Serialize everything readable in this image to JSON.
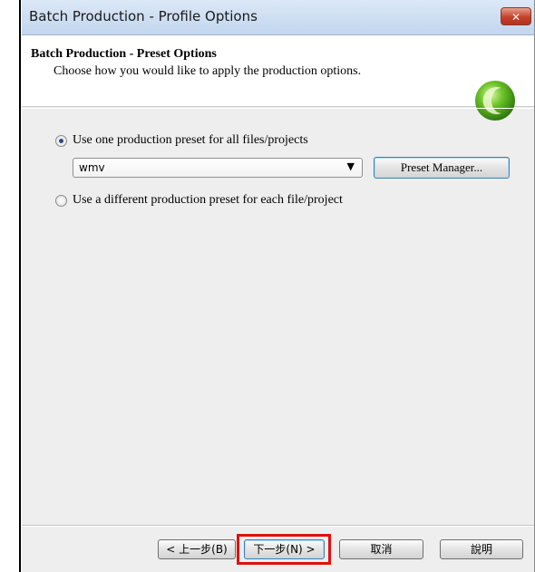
{
  "window": {
    "title": "Batch Production - Profile Options",
    "close_label": "✕"
  },
  "header": {
    "title": "Batch Production - Preset Options",
    "subtitle": "Choose how you would like to apply the production options.",
    "logo_icon": "green-circle-logo"
  },
  "options": {
    "one_preset_label": "Use one production preset for all files/projects",
    "one_preset_checked": true,
    "preset_select_value": "wmv",
    "preset_manager_label": "Preset Manager...",
    "different_preset_label": "Use a different production preset for each file/project",
    "different_preset_checked": false
  },
  "footer": {
    "back_label": "< 上一步(B)",
    "next_label": "下一步(N) >",
    "cancel_label": "取消",
    "help_label": "說明",
    "highlight_color": "#e01010"
  }
}
